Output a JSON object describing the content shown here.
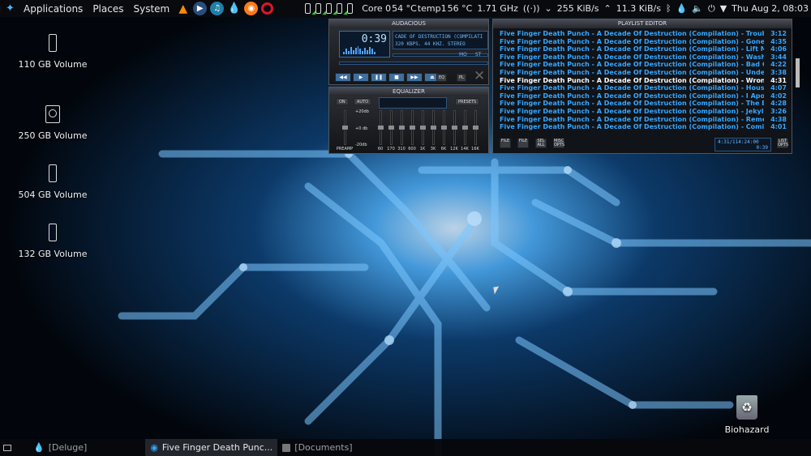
{
  "topbar": {
    "menus": [
      "Applications",
      "Places",
      "System"
    ],
    "launcher_icons": [
      "vlc-icon",
      "media-player-icon",
      "music-icon",
      "deluge-icon",
      "firefox-icon",
      "opera-icon"
    ],
    "cpu": "Core 0",
    "temp1": "54 °C",
    "temp_label": "temp1",
    "temp2": "56 °C",
    "freq": "1.71 GHz",
    "down": "255 KiB/s",
    "up": "11.3 KiB/s",
    "clock": "Thu Aug  2, 08:03"
  },
  "desktop": {
    "icons": [
      {
        "label": "110 GB Volume",
        "type": "drive-icon"
      },
      {
        "label": "250 GB Volume",
        "type": "hard-disk-icon"
      },
      {
        "label": "504 GB Volume",
        "type": "drive-icon"
      },
      {
        "label": "132 GB Volume",
        "type": "drive-icon"
      }
    ],
    "trash_label": "Biohazard"
  },
  "player": {
    "title": "AUDACIOUS",
    "time": "0:39",
    "track": "CADE OF DESTRUCTION (COMPILATI",
    "bitrate": "320 KBPS. 44 KHZ. STEREO",
    "mode_mono": "MO",
    "mode_stereo": "ST",
    "vis_bars": [
      0.3,
      0.6,
      0.4,
      0.8,
      0.5,
      0.7,
      0.9,
      0.6,
      0.4,
      0.7,
      0.5,
      0.8,
      0.6,
      0.3
    ],
    "eq_btn": "EQ",
    "pl_btn": "PL"
  },
  "equalizer": {
    "title": "EQUALIZER",
    "on": "ON",
    "auto": "AUTO",
    "presets": "PRESETS",
    "db_top": "+20db",
    "db_mid": "+0 db",
    "db_bot": "-20db",
    "preamp": "PREAMP",
    "bands": [
      "60",
      "170",
      "310",
      "600",
      "1K",
      "3K",
      "6K",
      "12K",
      "14K",
      "16K"
    ]
  },
  "playlist": {
    "title": "PLAYLIST EDITOR",
    "tracks": [
      {
        "title": "Five Finger Death Punch - A Decade Of Destruction (Compilation) - Trouble",
        "dur": "3:12"
      },
      {
        "title": "Five Finger Death Punch - A Decade Of Destruction (Compilation) - Gone ...",
        "dur": "4:35"
      },
      {
        "title": "Five Finger Death Punch - A Decade Of Destruction (Compilation) - Lift M...",
        "dur": "4:06"
      },
      {
        "title": "Five Finger Death Punch - A Decade Of Destruction (Compilation) - Wash ...",
        "dur": "3:44"
      },
      {
        "title": "Five Finger Death Punch - A Decade Of Destruction (Compilation) - Bad C...",
        "dur": "4:22"
      },
      {
        "title": "Five Finger Death Punch - A Decade Of Destruction (Compilation) - Under...",
        "dur": "3:38"
      },
      {
        "title": "Five Finger Death Punch - A Decade Of Destruction (Compilation) - Wron...",
        "dur": "4:31",
        "current": true
      },
      {
        "title": "Five Finger Death Punch - A Decade Of Destruction (Compilation) - House...",
        "dur": "4:07"
      },
      {
        "title": "Five Finger Death Punch - A Decade Of Destruction (Compilation) - I Apol...",
        "dur": "4:02"
      },
      {
        "title": "Five Finger Death Punch - A Decade Of Destruction (Compilation) - The B...",
        "dur": "4:28"
      },
      {
        "title": "Five Finger Death Punch - A Decade Of Destruction (Compilation) - Jekyll ...",
        "dur": "3:26"
      },
      {
        "title": "Five Finger Death Punch - A Decade Of Destruction (Compilation) - Reme...",
        "dur": "4:38"
      },
      {
        "title": "Five Finger Death Punch - A Decade Of Destruction (Compilation) - Comi...",
        "dur": "4:01"
      }
    ],
    "buttons": [
      "FILE",
      "FILE",
      "SEL ALL",
      "MISC OPTS"
    ],
    "total": "4:31/114:24:00",
    "elapsed": "0:39",
    "list_btn": "LIST OPTS"
  },
  "taskbar": {
    "tasks": [
      {
        "label": "[Deluge]",
        "icon": "deluge-icon",
        "active": false
      },
      {
        "label": "Five Finger Death Punc...",
        "icon": "audacious-icon",
        "active": true
      },
      {
        "label": "[Documents]",
        "icon": "folder-icon",
        "active": false
      }
    ]
  },
  "colors": {
    "accent": "#35a6ff",
    "lcd": "#0c1726",
    "panel": "#08090d"
  }
}
